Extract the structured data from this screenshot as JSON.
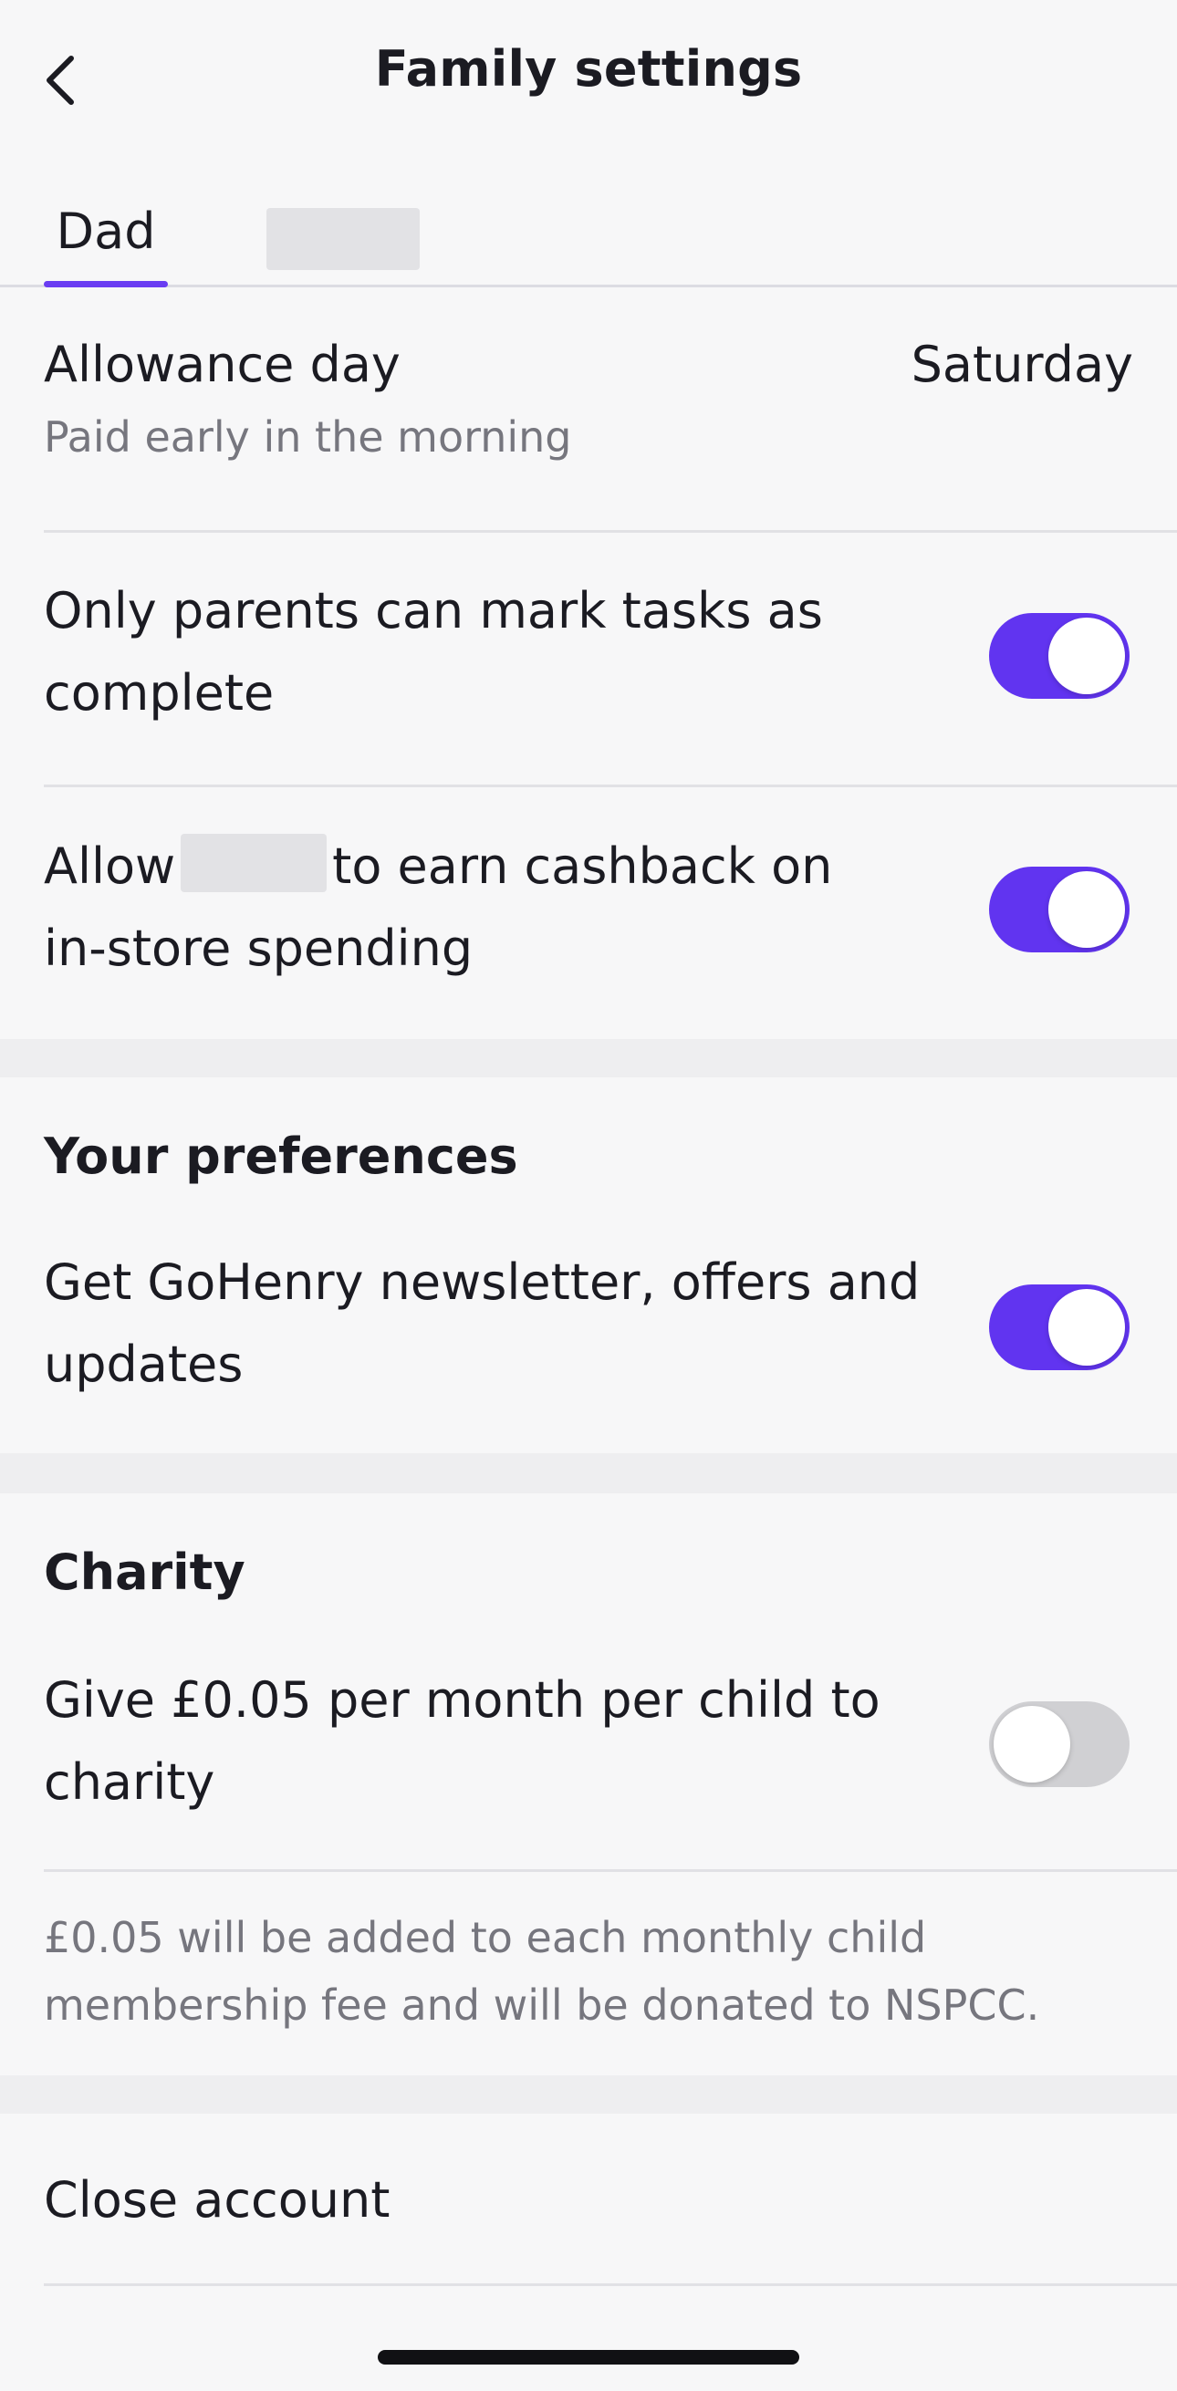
{
  "header": {
    "title": "Family settings",
    "back_icon": "chevron-left-icon"
  },
  "tabs": [
    {
      "label": "Dad",
      "active": true
    },
    {
      "label": "",
      "redacted": true
    }
  ],
  "colors": {
    "accent": "#6134f0",
    "toggle_off": "#d0d0d3"
  },
  "allowance": {
    "title": "Allowance day",
    "subtitle": "Paid early in the morning",
    "value": "Saturday"
  },
  "settings": {
    "only_parents": {
      "label": "Only parents can mark tasks as complete",
      "enabled": true
    },
    "cashback": {
      "label_prefix": "Allow",
      "label_suffix": "to earn cashback on in-store spending",
      "enabled": true
    }
  },
  "preferences": {
    "heading": "Your preferences",
    "newsletter": {
      "label": "Get GoHenry newsletter, offers and updates",
      "enabled": true
    }
  },
  "charity": {
    "heading": "Charity",
    "give": {
      "label": "Give £0.05 per month per child to charity",
      "enabled": false
    },
    "note": "£0.05 will be added to each monthly child membership fee and will be donated to NSPCC."
  },
  "close_account": {
    "label": "Close account"
  }
}
